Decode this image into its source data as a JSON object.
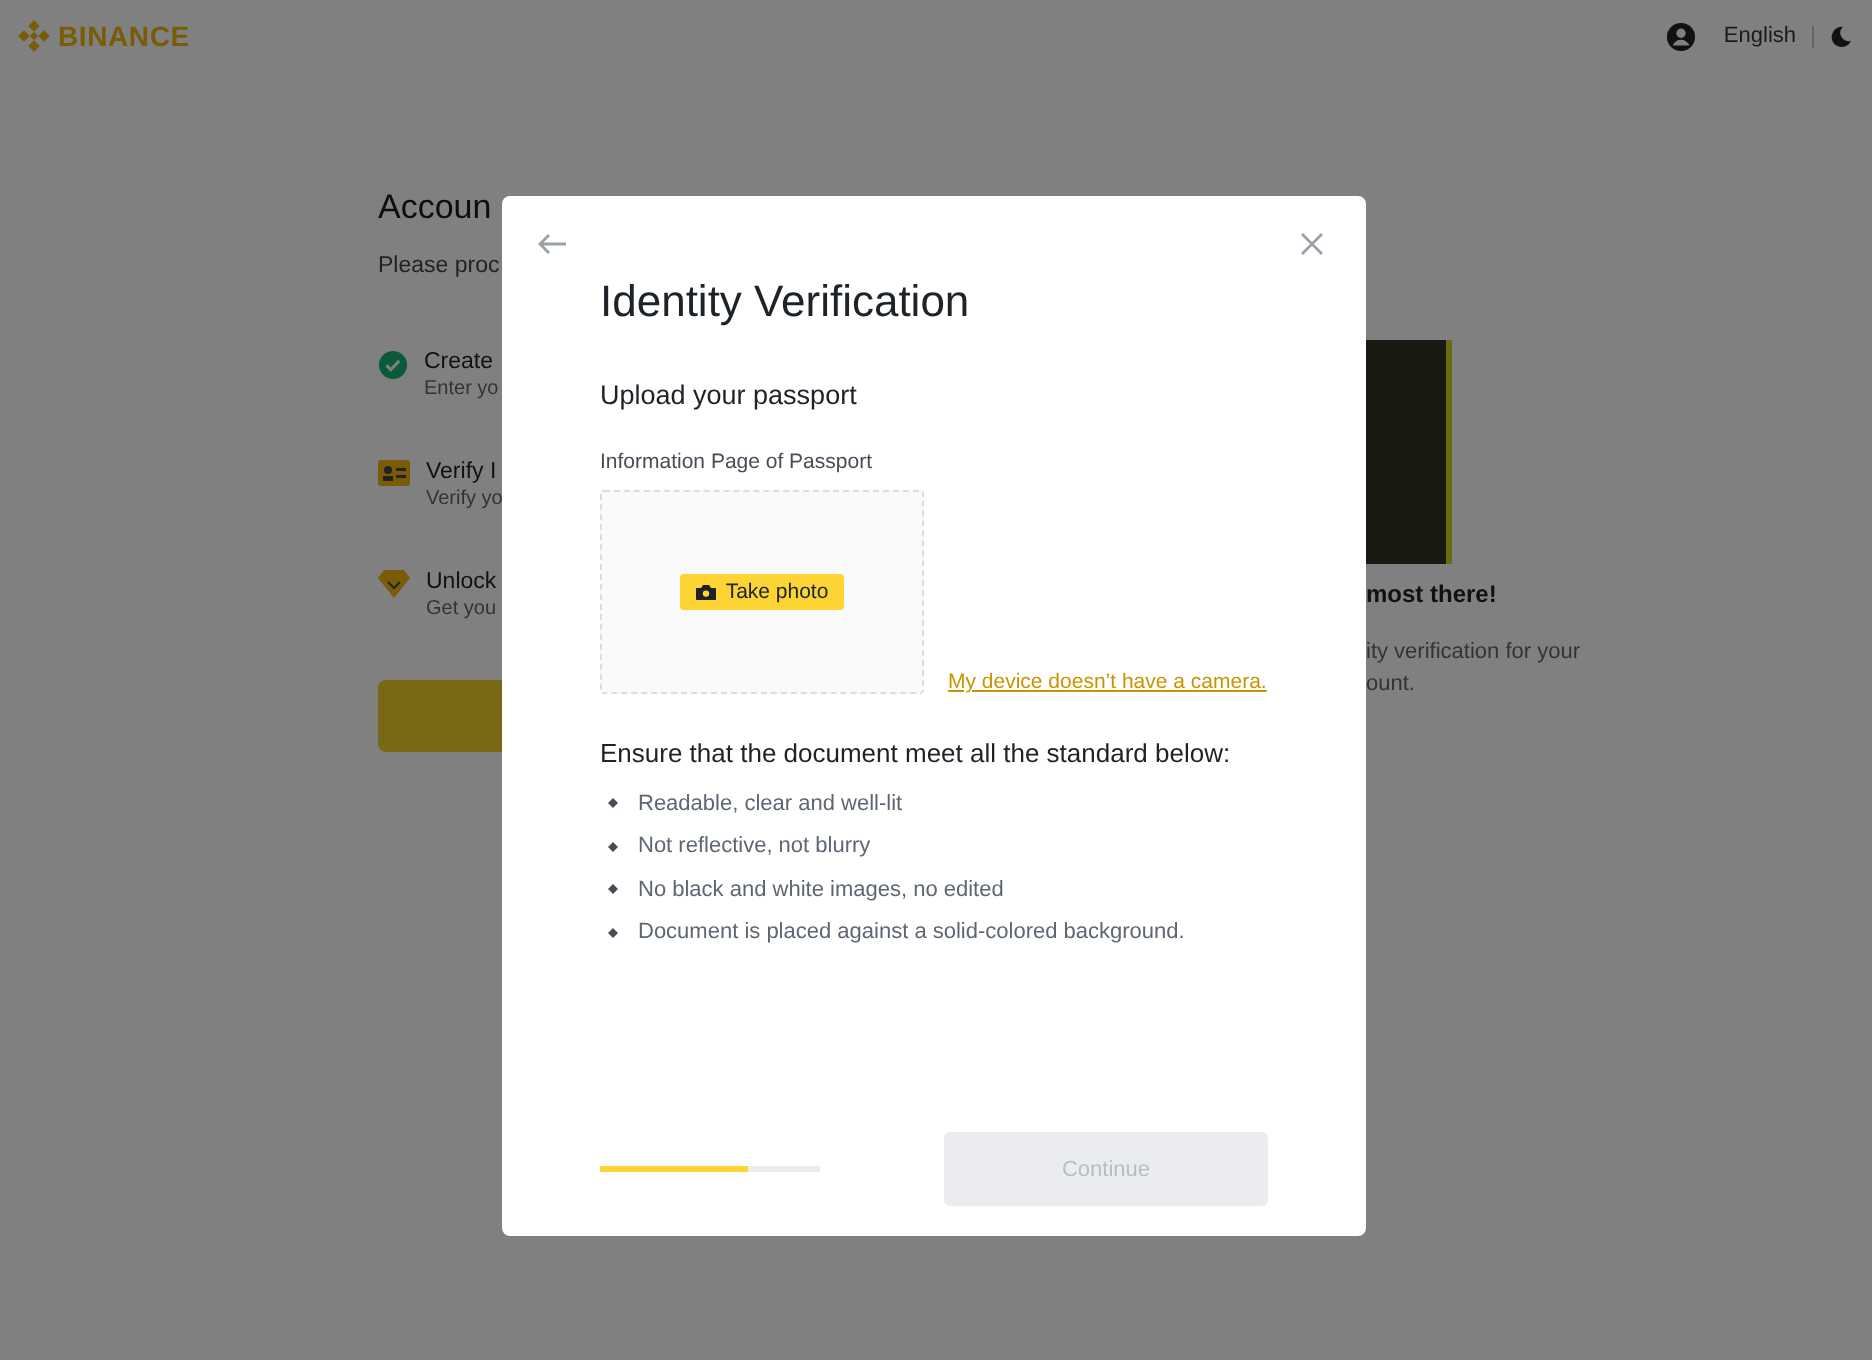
{
  "header": {
    "logo": "BINANCE",
    "language": "English"
  },
  "background": {
    "title": "Accoun",
    "subtitle": "Please proc",
    "steps": [
      {
        "kind": "done",
        "title": "Create",
        "description": "Enter yo"
      },
      {
        "kind": "id",
        "title": "Verify I",
        "description": "Verify yo"
      },
      {
        "kind": "unlock",
        "title": "Unlock",
        "description": "Get you"
      }
    ],
    "promo_title": "most there!",
    "promo_lines": [
      "ity verification for your",
      "ount."
    ]
  },
  "modal": {
    "title": "Identity Verification",
    "section": "Upload your passport",
    "field_label": "Information Page of Passport",
    "take_photo": "Take photo",
    "no_camera_link": "My device doesn’t have a camera.",
    "requirements_title": "Ensure that the document meet all the standard below:",
    "requirements": [
      "Readable, clear and well-lit",
      "Not reflective, not blurry",
      "No black and white images, no edited",
      "Document is placed against a solid-colored background."
    ],
    "progress": {
      "level": 0.67
    },
    "continue": {
      "label": "Continue",
      "disabled": true
    }
  }
}
